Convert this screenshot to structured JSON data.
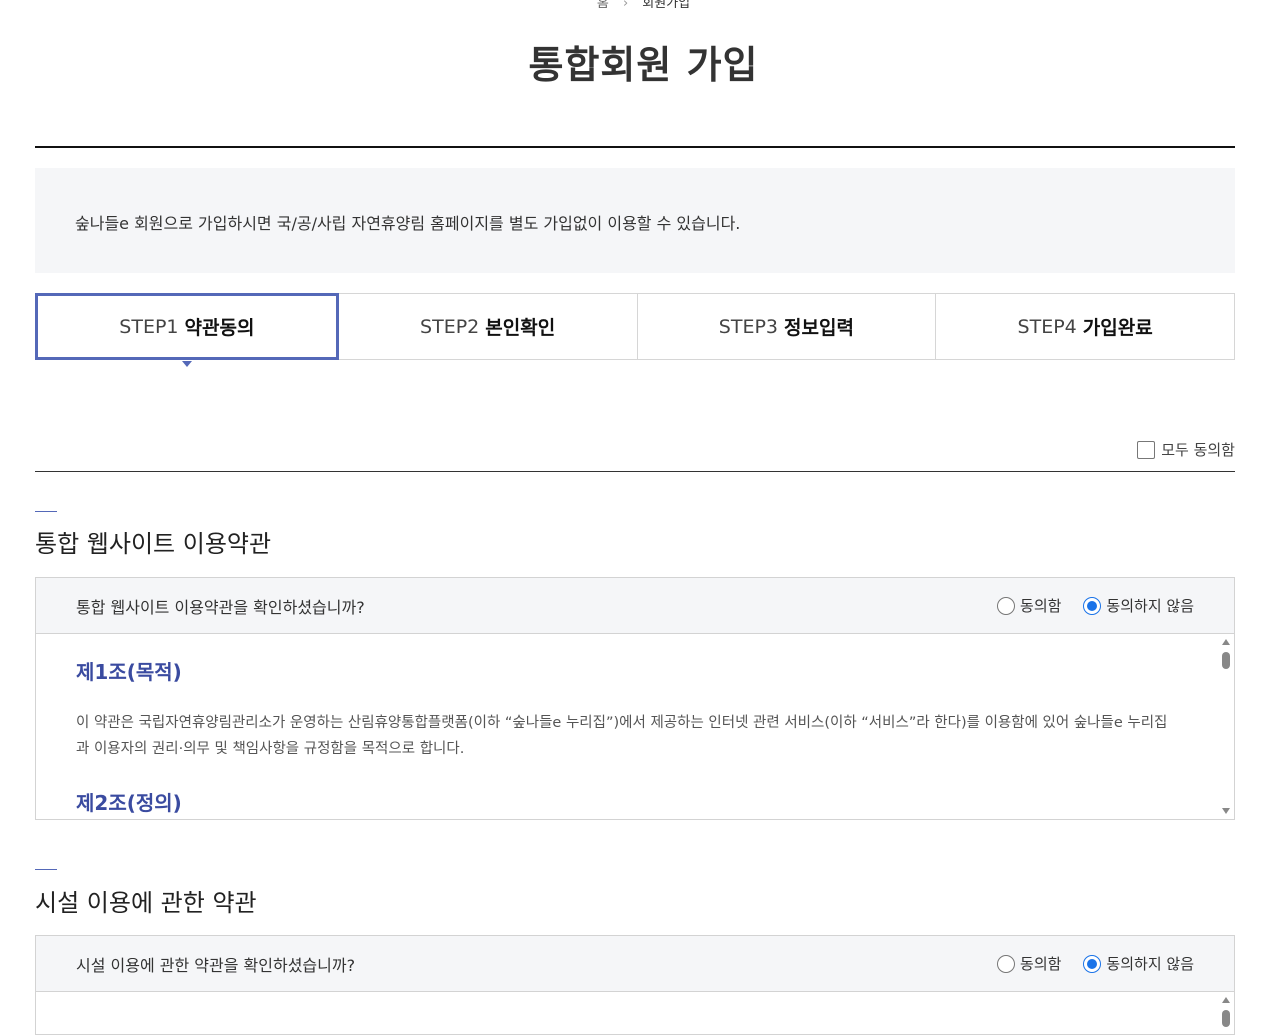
{
  "breadcrumb": {
    "home": "홈",
    "current": "회원가입"
  },
  "page_title": "통합회원 가입",
  "notice": "숲나들e 회원으로 가입하시면 국/공/사립 자연휴양림 홈페이지를 별도 가입없이 이용할 수 있습니다.",
  "steps": [
    {
      "num": "STEP1",
      "name": "약관동의",
      "active": true
    },
    {
      "num": "STEP2",
      "name": "본인확인",
      "active": false
    },
    {
      "num": "STEP3",
      "name": "정보입력",
      "active": false
    },
    {
      "num": "STEP4",
      "name": "가입완료",
      "active": false
    }
  ],
  "agree_all": {
    "label": "모두 동의함",
    "checked": false
  },
  "sections": [
    {
      "title": "통합 웹사이트 이용약관",
      "question": "통합 웹사이트 이용약관을 확인하셨습니까?",
      "agree_label": "동의함",
      "disagree_label": "동의하지 않음",
      "selected": "disagree",
      "articles": [
        {
          "title": "제1조(목적)",
          "text": "이 약관은 국립자연휴양림관리소가 운영하는 산림휴양통합플랫폼(이하 “숲나들e 누리집”)에서 제공하는 인터넷 관련 서비스(이하 “서비스”라 한다)를 이용함에 있어 숲나들e 누리집과 이용자의 권리·의무 및 책임사항을 규정함을 목적으로 합니다."
        },
        {
          "title": "제2조(정의)",
          "text": ""
        }
      ]
    },
    {
      "title": "시설 이용에 관한 약관",
      "question": "시설 이용에 관한 약관을 확인하셨습니까?",
      "agree_label": "동의함",
      "disagree_label": "동의하지 않음",
      "selected": "disagree"
    }
  ],
  "colors": {
    "accent": "#5468b8",
    "article_title": "#3a4ba0",
    "radio_selected": "#1a73e8",
    "panel_bg": "#f5f6f8"
  }
}
